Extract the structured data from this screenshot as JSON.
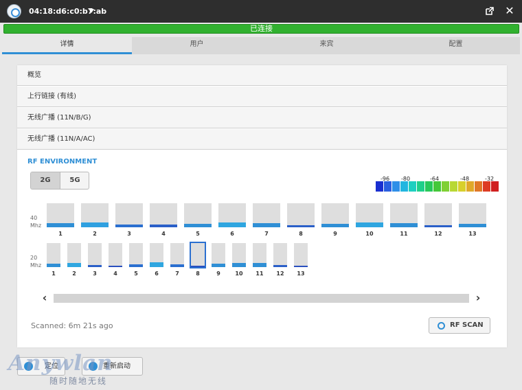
{
  "titlebar": {
    "device_mac": "04:18:d6:c0:b7:ab"
  },
  "status": {
    "text": "已连接",
    "color": "#31b12f"
  },
  "tabs": [
    {
      "label": "详情",
      "active": true
    },
    {
      "label": "用户",
      "active": false
    },
    {
      "label": "来宾",
      "active": false
    },
    {
      "label": "配置",
      "active": false
    }
  ],
  "sections": [
    {
      "label": "概览"
    },
    {
      "label": "上行链接 (有线)"
    },
    {
      "label": "无线广播 (11N/B/G)"
    },
    {
      "label": "无线广播 (11N/A/AC)"
    }
  ],
  "rf": {
    "title": "RF ENVIRONMENT",
    "bands": [
      {
        "label": "2G",
        "selected": true
      },
      {
        "label": "5G",
        "selected": false
      }
    ],
    "legend_values": [
      "-96",
      "-80",
      "-64",
      "-48",
      "-32"
    ],
    "legend_colors": [
      "#1a2fd0",
      "#2a5fe0",
      "#2f8fe8",
      "#22b6e0",
      "#1ecfc0",
      "#1fcf8a",
      "#28c85a",
      "#44c83a",
      "#7fd034",
      "#b8d834",
      "#d8d02c",
      "#e0a82a",
      "#e07828",
      "#dd3c24",
      "#d01f1f"
    ],
    "row40": {
      "label_top": "40",
      "label_bottom": "Mhz",
      "channels": [
        {
          "label": "1",
          "fill": 0.18,
          "color": "#2f8fd5"
        },
        {
          "label": "2",
          "fill": 0.2,
          "color": "#2fa0e0"
        },
        {
          "label": "3",
          "fill": 0.12,
          "color": "#2a6fd0"
        },
        {
          "label": "4",
          "fill": 0.1,
          "color": "#2a5fc8"
        },
        {
          "label": "5",
          "fill": 0.14,
          "color": "#2f8fd5"
        },
        {
          "label": "6",
          "fill": 0.2,
          "color": "#2fa6e0"
        },
        {
          "label": "7",
          "fill": 0.17,
          "color": "#2f8fd5"
        },
        {
          "label": "8",
          "fill": 0.09,
          "color": "#2a5fc8"
        },
        {
          "label": "9",
          "fill": 0.15,
          "color": "#2f8fd5"
        },
        {
          "label": "10",
          "fill": 0.2,
          "color": "#2fa6e0"
        },
        {
          "label": "11",
          "fill": 0.17,
          "color": "#2f8fd5"
        },
        {
          "label": "12",
          "fill": 0.09,
          "color": "#2a5fc8"
        },
        {
          "label": "13",
          "fill": 0.15,
          "color": "#2f8fd5"
        }
      ]
    },
    "row20": {
      "label_top": "20",
      "label_bottom": "Mhz",
      "channels": [
        {
          "label": "1",
          "fill": 0.15,
          "color": "#2f8fd5",
          "highlight": false
        },
        {
          "label": "2",
          "fill": 0.18,
          "color": "#2fa6e0",
          "highlight": false
        },
        {
          "label": "3",
          "fill": 0.08,
          "color": "#2a5fc8",
          "highlight": false
        },
        {
          "label": "4",
          "fill": 0.04,
          "color": "#2a4fbf",
          "highlight": false
        },
        {
          "label": "5",
          "fill": 0.1,
          "color": "#2a6fd0",
          "highlight": false
        },
        {
          "label": "6",
          "fill": 0.2,
          "color": "#2fa6e0",
          "highlight": false
        },
        {
          "label": "7",
          "fill": 0.1,
          "color": "#2a6fd0",
          "highlight": false
        },
        {
          "label": "8",
          "fill": 0.02,
          "color": "#2a4fbf",
          "highlight": true
        },
        {
          "label": "9",
          "fill": 0.14,
          "color": "#2f8fd5",
          "highlight": false
        },
        {
          "label": "10",
          "fill": 0.16,
          "color": "#2f8fd5",
          "highlight": false
        },
        {
          "label": "11",
          "fill": 0.16,
          "color": "#2f8fd5",
          "highlight": false
        },
        {
          "label": "12",
          "fill": 0.08,
          "color": "#2a5fc8",
          "highlight": false
        },
        {
          "label": "13",
          "fill": 0.03,
          "color": "#2a4fbf",
          "highlight": false
        }
      ]
    },
    "scanned_text": "Scanned: 6m 21s ago",
    "scan_button": "RF SCAN"
  },
  "bottom_buttons": [
    {
      "label": "定位",
      "icon": "locate-icon"
    },
    {
      "label": "重新启动",
      "icon": "restart-icon"
    }
  ],
  "watermark": {
    "brand": "Anywlan",
    "slogan": "随时随地无线"
  }
}
